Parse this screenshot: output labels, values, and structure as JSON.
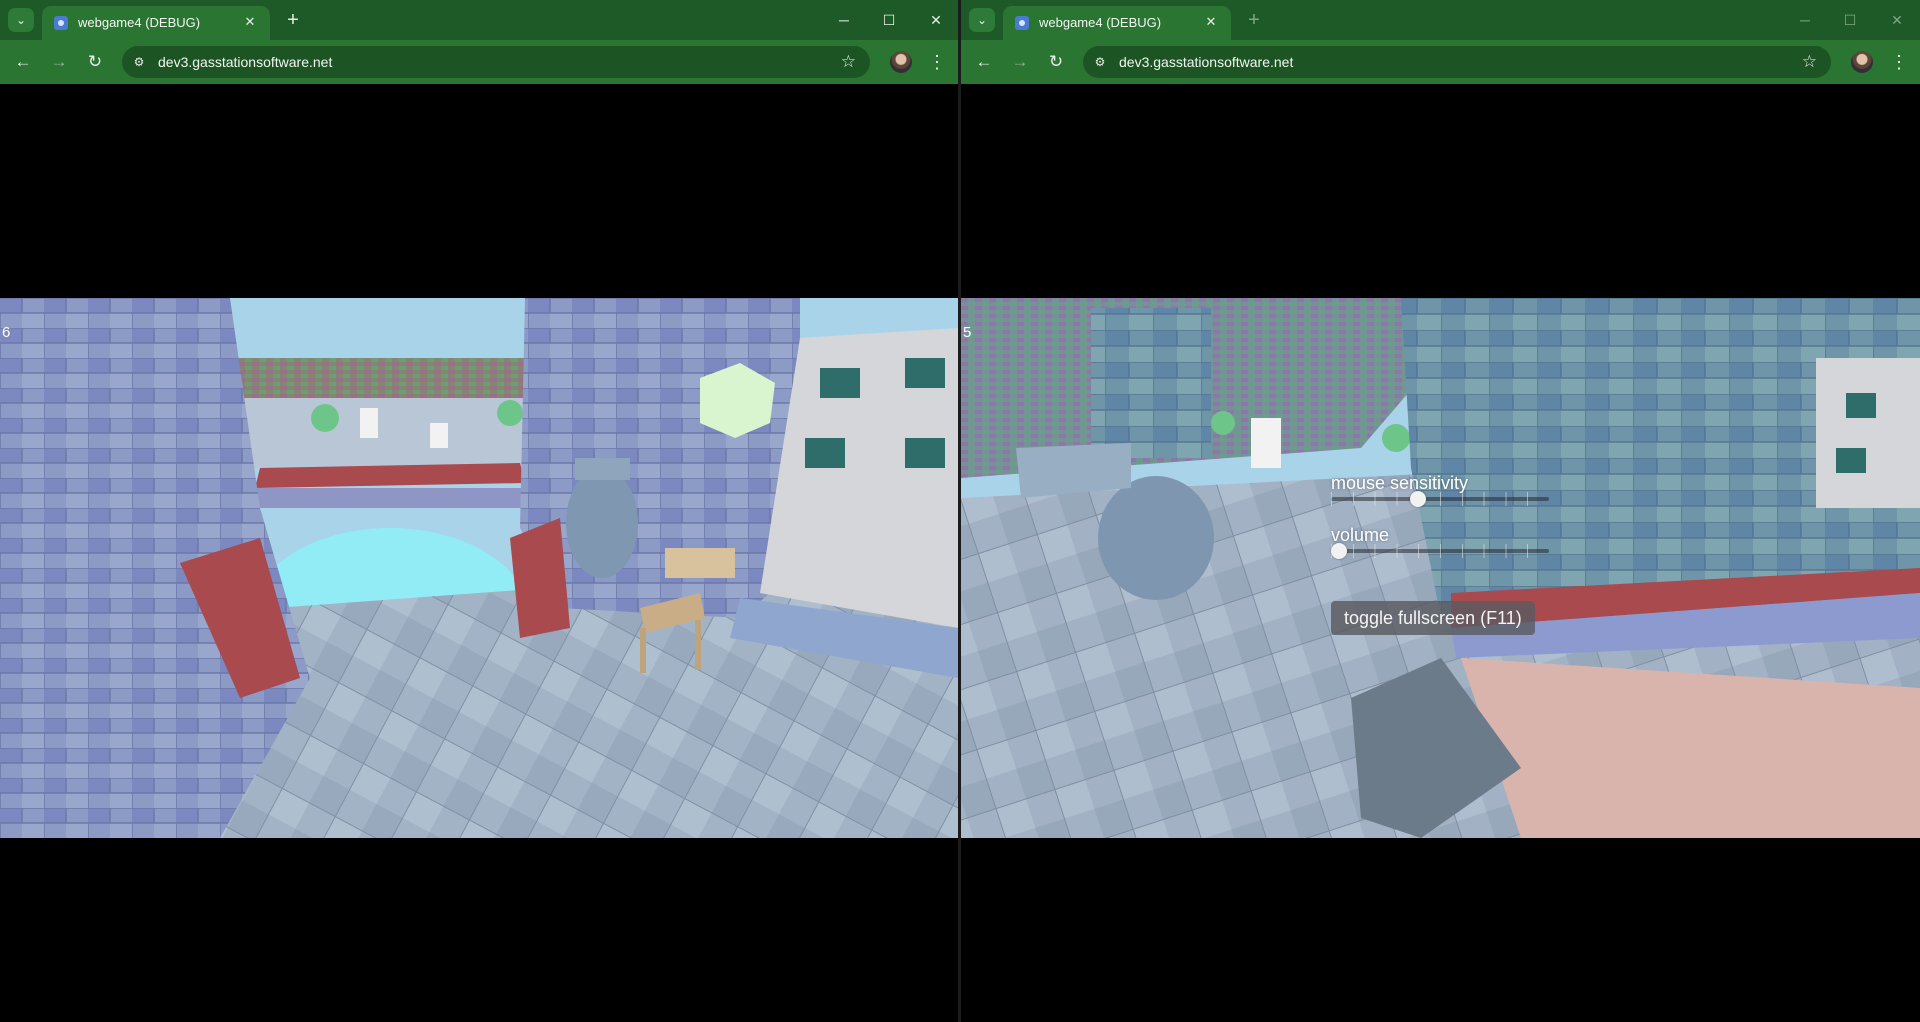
{
  "windows": [
    {
      "tab": {
        "title": "webgame4 (DEBUG)",
        "close": "✕"
      },
      "tab_menu": "⌄",
      "new_tab": "+",
      "controls": {
        "minimize": "─",
        "maximize": "☐",
        "close": "✕"
      },
      "nav": {
        "back": "←",
        "forward": "→",
        "reload": "↻"
      },
      "address": {
        "site_icon": "⚙",
        "url": "dev3.gasstationsoftware.net",
        "star": "☆"
      },
      "menu": "⋮",
      "game": {
        "fps": "6"
      }
    },
    {
      "tab": {
        "title": "webgame4 (DEBUG)",
        "close": "✕"
      },
      "tab_menu": "⌄",
      "new_tab": "+",
      "controls": {
        "minimize": "─",
        "maximize": "☐",
        "close": "✕"
      },
      "nav": {
        "back": "←",
        "forward": "→",
        "reload": "↻"
      },
      "address": {
        "site_icon": "⚙",
        "url": "dev3.gasstationsoftware.net",
        "star": "☆"
      },
      "menu": "⋮",
      "game": {
        "fps": "5",
        "settings": {
          "mouse_sensitivity": {
            "label": "mouse sensitivity",
            "value": 0.4
          },
          "volume": {
            "label": "volume",
            "value": 0.0
          },
          "fullscreen_button": "toggle fullscreen (F11)"
        }
      }
    }
  ],
  "colors": {
    "tabbar": "#1e5a27",
    "toolbar": "#2b7533",
    "omnibox": "#1d5424",
    "sky": "#a9d3e9",
    "water": "#92ecf6",
    "pavement": "#9fb1c3",
    "wall": "#8e9cc5",
    "ledge": "#a84a4e"
  },
  "icons": [
    "tab-list-icon",
    "favicon-icon",
    "close-icon",
    "plus-icon",
    "minimize-icon",
    "maximize-icon",
    "back-arrow-icon",
    "forward-arrow-icon",
    "reload-icon",
    "site-info-icon",
    "star-icon",
    "profile-avatar",
    "kebab-menu-icon"
  ]
}
